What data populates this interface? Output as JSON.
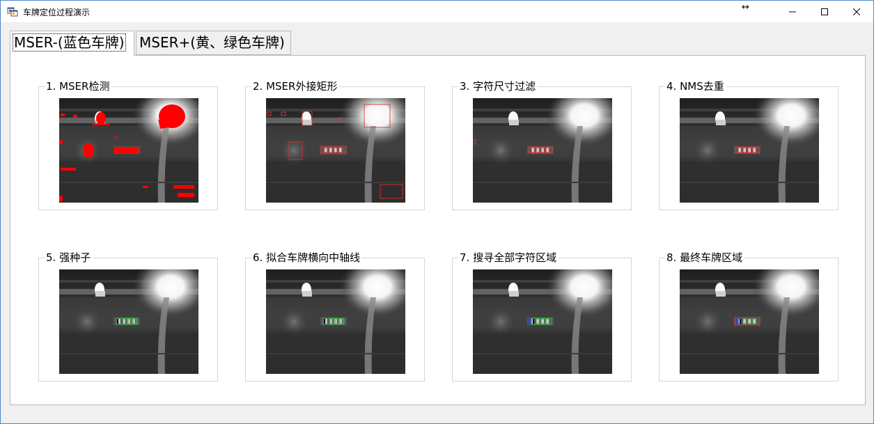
{
  "window": {
    "title": "车牌定位过程演示",
    "icons": {
      "app": "app-window-icon",
      "resize": "resize-arrows-icon",
      "minimize": "minimize-icon",
      "maximize": "maximize-icon",
      "close": "close-icon"
    }
  },
  "tabs": [
    {
      "label": "MSER-(蓝色车牌)",
      "active": true
    },
    {
      "label": "MSER+(黄、绿色车牌)",
      "active": false
    }
  ],
  "steps": [
    {
      "title": "1. MSER检测"
    },
    {
      "title": "2. MSER外接矩形"
    },
    {
      "title": "3. 字符尺寸过滤"
    },
    {
      "title": "4. NMS去重"
    },
    {
      "title": "5. 强种子"
    },
    {
      "title": "6. 拟合车牌横向中轴线"
    },
    {
      "title": "7. 搜寻全部字符区域"
    },
    {
      "title": "8. 最终车牌区域"
    }
  ],
  "colors": {
    "mser_region": "#ff0000",
    "rect_box": "#e03030",
    "seed_box": "#3cb44b",
    "axis_box": "#1e3cff",
    "final_box": "#e03030"
  }
}
